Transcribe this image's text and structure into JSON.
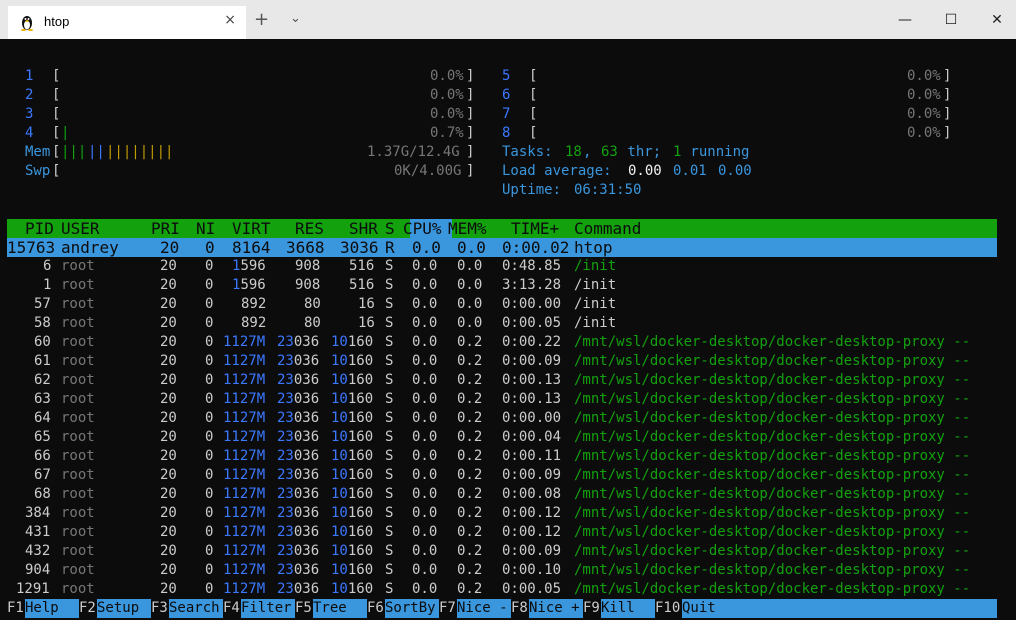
{
  "window": {
    "tab_title": "htop",
    "tab_close": "×",
    "new_tab": "+",
    "dropdown": "⌄",
    "minimize": "—",
    "maximize": "☐",
    "close": "✕"
  },
  "meters": {
    "cpus_left": [
      {
        "id": "1",
        "bar": "",
        "pct": "0.0%"
      },
      {
        "id": "2",
        "bar": "",
        "pct": "0.0%"
      },
      {
        "id": "3",
        "bar": "",
        "pct": "0.0%"
      },
      {
        "id": "4",
        "bar": "|",
        "pct": "0.7%"
      }
    ],
    "cpus_right": [
      {
        "id": "5",
        "bar": "",
        "pct": "0.0%"
      },
      {
        "id": "6",
        "bar": "",
        "pct": "0.0%"
      },
      {
        "id": "7",
        "bar": "",
        "pct": "0.0%"
      },
      {
        "id": "8",
        "bar": "",
        "pct": "0.0%"
      }
    ],
    "mem": {
      "label": "Mem",
      "bar_green": "|||",
      "bar_blue": "||",
      "bar_yellow": "||||||||",
      "value": "1.37G/12.4G"
    },
    "swp": {
      "label": "Swp",
      "value": "0K/4.00G"
    },
    "tasks": {
      "label": "Tasks: ",
      "count": "18",
      "sep": ", ",
      "threads": "63",
      "thr_label": " thr; ",
      "running": "1",
      "running_label": " running"
    },
    "load": {
      "label": "Load average: ",
      "v1": "0.00",
      "v2": "0.01",
      "v3": "0.00"
    },
    "uptime": {
      "label": "Uptime: ",
      "value": "06:31:50"
    }
  },
  "table": {
    "columns": [
      "PID",
      "USER",
      "PRI",
      "NI",
      "VIRT",
      "RES",
      "SHR",
      "S",
      "CPU%",
      "MEM%",
      "TIME+",
      "Command"
    ],
    "rows": [
      {
        "pid": "15763",
        "user": "andrey",
        "pri": "20",
        "ni": "0",
        "virt": "8164",
        "res": "3668",
        "shr": "3036",
        "s": "R",
        "cpu": "0.0",
        "mem": "0.0",
        "time": "0:00.02",
        "cmd": "htop"
      },
      {
        "pid": "6",
        "user": "root",
        "pri": "20",
        "ni": "0",
        "virt": "1596",
        "res": "908",
        "shr": "516",
        "s": "S",
        "cpu": "0.0",
        "mem": "0.0",
        "time": "0:48.85",
        "cmd": "/init"
      },
      {
        "pid": "1",
        "user": "root",
        "pri": "20",
        "ni": "0",
        "virt": "1596",
        "res": "908",
        "shr": "516",
        "s": "S",
        "cpu": "0.0",
        "mem": "0.0",
        "time": "3:13.28",
        "cmd": "/init"
      },
      {
        "pid": "57",
        "user": "root",
        "pri": "20",
        "ni": "0",
        "virt": "892",
        "res": "80",
        "shr": "16",
        "s": "S",
        "cpu": "0.0",
        "mem": "0.0",
        "time": "0:00.00",
        "cmd": "/init"
      },
      {
        "pid": "58",
        "user": "root",
        "pri": "20",
        "ni": "0",
        "virt": "892",
        "res": "80",
        "shr": "16",
        "s": "S",
        "cpu": "0.0",
        "mem": "0.0",
        "time": "0:00.05",
        "cmd": "/init"
      },
      {
        "pid": "60",
        "user": "root",
        "pri": "20",
        "ni": "0",
        "virt": "1127M",
        "res": "23036",
        "shr": "10160",
        "s": "S",
        "cpu": "0.0",
        "mem": "0.2",
        "time": "0:00.22",
        "cmd": "/mnt/wsl/docker-desktop/docker-desktop-proxy --"
      },
      {
        "pid": "61",
        "user": "root",
        "pri": "20",
        "ni": "0",
        "virt": "1127M",
        "res": "23036",
        "shr": "10160",
        "s": "S",
        "cpu": "0.0",
        "mem": "0.2",
        "time": "0:00.09",
        "cmd": "/mnt/wsl/docker-desktop/docker-desktop-proxy --"
      },
      {
        "pid": "62",
        "user": "root",
        "pri": "20",
        "ni": "0",
        "virt": "1127M",
        "res": "23036",
        "shr": "10160",
        "s": "S",
        "cpu": "0.0",
        "mem": "0.2",
        "time": "0:00.13",
        "cmd": "/mnt/wsl/docker-desktop/docker-desktop-proxy --"
      },
      {
        "pid": "63",
        "user": "root",
        "pri": "20",
        "ni": "0",
        "virt": "1127M",
        "res": "23036",
        "shr": "10160",
        "s": "S",
        "cpu": "0.0",
        "mem": "0.2",
        "time": "0:00.13",
        "cmd": "/mnt/wsl/docker-desktop/docker-desktop-proxy --"
      },
      {
        "pid": "64",
        "user": "root",
        "pri": "20",
        "ni": "0",
        "virt": "1127M",
        "res": "23036",
        "shr": "10160",
        "s": "S",
        "cpu": "0.0",
        "mem": "0.2",
        "time": "0:00.00",
        "cmd": "/mnt/wsl/docker-desktop/docker-desktop-proxy --"
      },
      {
        "pid": "65",
        "user": "root",
        "pri": "20",
        "ni": "0",
        "virt": "1127M",
        "res": "23036",
        "shr": "10160",
        "s": "S",
        "cpu": "0.0",
        "mem": "0.2",
        "time": "0:00.04",
        "cmd": "/mnt/wsl/docker-desktop/docker-desktop-proxy --"
      },
      {
        "pid": "66",
        "user": "root",
        "pri": "20",
        "ni": "0",
        "virt": "1127M",
        "res": "23036",
        "shr": "10160",
        "s": "S",
        "cpu": "0.0",
        "mem": "0.2",
        "time": "0:00.11",
        "cmd": "/mnt/wsl/docker-desktop/docker-desktop-proxy --"
      },
      {
        "pid": "67",
        "user": "root",
        "pri": "20",
        "ni": "0",
        "virt": "1127M",
        "res": "23036",
        "shr": "10160",
        "s": "S",
        "cpu": "0.0",
        "mem": "0.2",
        "time": "0:00.09",
        "cmd": "/mnt/wsl/docker-desktop/docker-desktop-proxy --"
      },
      {
        "pid": "68",
        "user": "root",
        "pri": "20",
        "ni": "0",
        "virt": "1127M",
        "res": "23036",
        "shr": "10160",
        "s": "S",
        "cpu": "0.0",
        "mem": "0.2",
        "time": "0:00.08",
        "cmd": "/mnt/wsl/docker-desktop/docker-desktop-proxy --"
      },
      {
        "pid": "384",
        "user": "root",
        "pri": "20",
        "ni": "0",
        "virt": "1127M",
        "res": "23036",
        "shr": "10160",
        "s": "S",
        "cpu": "0.0",
        "mem": "0.2",
        "time": "0:00.12",
        "cmd": "/mnt/wsl/docker-desktop/docker-desktop-proxy --"
      },
      {
        "pid": "431",
        "user": "root",
        "pri": "20",
        "ni": "0",
        "virt": "1127M",
        "res": "23036",
        "shr": "10160",
        "s": "S",
        "cpu": "0.0",
        "mem": "0.2",
        "time": "0:00.12",
        "cmd": "/mnt/wsl/docker-desktop/docker-desktop-proxy --"
      },
      {
        "pid": "432",
        "user": "root",
        "pri": "20",
        "ni": "0",
        "virt": "1127M",
        "res": "23036",
        "shr": "10160",
        "s": "S",
        "cpu": "0.0",
        "mem": "0.2",
        "time": "0:00.09",
        "cmd": "/mnt/wsl/docker-desktop/docker-desktop-proxy --"
      },
      {
        "pid": "904",
        "user": "root",
        "pri": "20",
        "ni": "0",
        "virt": "1127M",
        "res": "23036",
        "shr": "10160",
        "s": "S",
        "cpu": "0.0",
        "mem": "0.2",
        "time": "0:00.10",
        "cmd": "/mnt/wsl/docker-desktop/docker-desktop-proxy --"
      },
      {
        "pid": "1291",
        "user": "root",
        "pri": "20",
        "ni": "0",
        "virt": "1127M",
        "res": "23036",
        "shr": "10160",
        "s": "S",
        "cpu": "0.0",
        "mem": "0.2",
        "time": "0:00.05",
        "cmd": "/mnt/wsl/docker-desktop/docker-desktop-proxy --"
      }
    ]
  },
  "function_keys": [
    {
      "key": "F1",
      "label": "Help  "
    },
    {
      "key": "F2",
      "label": "Setup "
    },
    {
      "key": "F3",
      "label": "Search"
    },
    {
      "key": "F4",
      "label": "Filter"
    },
    {
      "key": "F5",
      "label": "Tree  "
    },
    {
      "key": "F6",
      "label": "SortBy"
    },
    {
      "key": "F7",
      "label": "Nice -"
    },
    {
      "key": "F8",
      "label": "Nice +"
    },
    {
      "key": "F9",
      "label": "Kill  "
    },
    {
      "key": "F10",
      "label": "Quit"
    }
  ],
  "colors": {
    "background": "#0c0c0c",
    "header": "#13a10e",
    "selection": "#3a96dd",
    "text": "#cccccc"
  }
}
